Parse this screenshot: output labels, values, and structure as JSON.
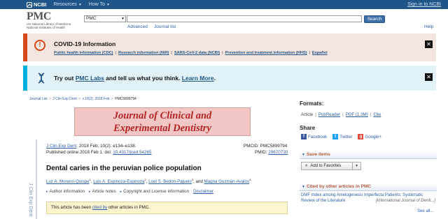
{
  "ncbi": {
    "logo": "NCBI",
    "menu": [
      "Resources",
      "How To"
    ],
    "signin": "Sign in to NCBI"
  },
  "pmc_header": {
    "logo": "PMC",
    "logo_sub_1": "US National Library of Medicine",
    "logo_sub_2": "National Institutes of Health",
    "db_value": "PMC",
    "search_value": "",
    "search_button": "Search",
    "advanced": "Advanced",
    "journal_list": "Journal list",
    "help": "Help"
  },
  "covid": {
    "title": "COVID-19 Information",
    "links": [
      "Public health information (CDC)",
      "Research information (NIH)",
      "SARS-CoV-2 data (NCBI)",
      "Prevention and treatment information (HHS)",
      "Español"
    ],
    "close": "✕"
  },
  "labs": {
    "prefix": "Try out ",
    "link": "PMC Labs",
    "middle": " and tell us what you think. ",
    "learn_more": "Learn More",
    "suffix": ".",
    "close": "✕"
  },
  "breadcrumb": [
    "Journal List",
    "J Clin Exp Dent",
    "v.10(2); 2018 Feb",
    "PMC5899794"
  ],
  "journal_banner": {
    "line1": "Journal of Clinical and",
    "line2": "Experimental Dentistry"
  },
  "side_text": "J Clin Exp Dent",
  "citation": {
    "journal": "J Clin Exp Dent",
    "rest": ". 2018 Feb; 10(2): e134–e138.",
    "published": "Published online 2018 Feb 1. doi: ",
    "doi": "10.4317/jced.54265"
  },
  "ids": {
    "pmcid_label": "PMCID:",
    "pmcid": "PMC5899794",
    "pmid_label": "PMID:",
    "pmid": "29670730"
  },
  "article": {
    "title": "Dental caries in the peruvian police population",
    "authors": [
      {
        "name": "Luz A. Moreno-Quispe",
        "sup": "1"
      },
      {
        "name": "Luis A. Espinoza-Espinoza",
        "sup": "2"
      },
      {
        "name": "Loel S. Bedón-Pajuelo",
        "sup": "3"
      },
      {
        "name": "Magna Guzmán-Avalos",
        "sup": "4"
      }
    ],
    "and": "and",
    "tools": [
      "Author information",
      "Article notes",
      "Copyright and License information"
    ],
    "disclaimer": "Disclaimer"
  },
  "cited_box": {
    "prefix": "This article has been ",
    "link": "cited by",
    "suffix": " other articles in PMC."
  },
  "right": {
    "formats_head": "Formats:",
    "formats": [
      "Article",
      "PubReader",
      "PDF (1.3M)",
      "Cite"
    ],
    "share_head": "Share",
    "share": [
      "Facebook",
      "Twitter",
      "Google+"
    ],
    "save_head": "Save items",
    "add_fav": "Add to Favorites",
    "cited_head": "Cited by other articles in PMC",
    "cited_item": "DMF Index among Amelogenesis Imperfecta Patients: Systematic Review of the Literature",
    "cited_source": "[International Journal of Denti...]",
    "see_all": "See all..."
  },
  "colors": {
    "ncbi_bar": "#20558a",
    "covid_accent": "#d8471a",
    "labs_accent": "#00b0dc",
    "journal_banner_bg": "#f1c6c4",
    "journal_title": "#b32424"
  }
}
